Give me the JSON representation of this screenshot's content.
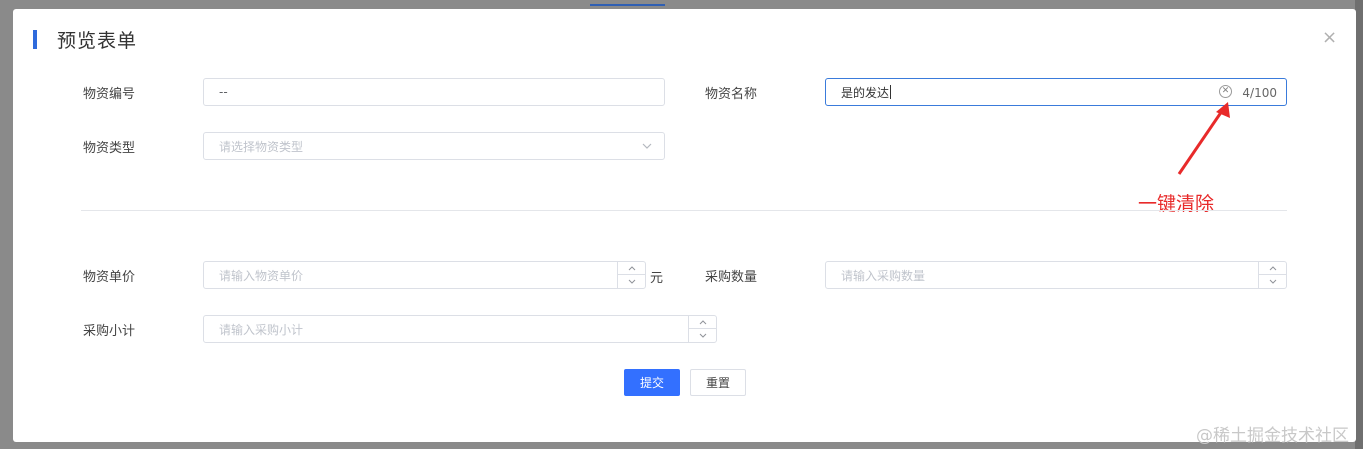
{
  "dialog": {
    "title": "预览表单",
    "close_icon": "close-icon"
  },
  "fields": {
    "material_no": {
      "label": "物资编号",
      "value": "--"
    },
    "material_name": {
      "label": "物资名称",
      "value": "是的发达",
      "counter": "4/100"
    },
    "material_type": {
      "label": "物资类型",
      "placeholder": "请选择物资类型"
    },
    "unit_price": {
      "label": "物资单价",
      "placeholder": "请输入物资单价",
      "unit": "元"
    },
    "purchase_qty": {
      "label": "采购数量",
      "placeholder": "请输入采购数量"
    },
    "purchase_subtotal": {
      "label": "采购小计",
      "placeholder": "请输入采购小计"
    }
  },
  "buttons": {
    "submit": "提交",
    "reset": "重置"
  },
  "annotation": {
    "text": "一键清除",
    "color": "#e82a2a"
  },
  "watermark": "@稀土掘金技术社区",
  "colors": {
    "accent": "#2f6bdc",
    "primary_button": "#3370ff",
    "focus_border": "#3a7bdb"
  }
}
